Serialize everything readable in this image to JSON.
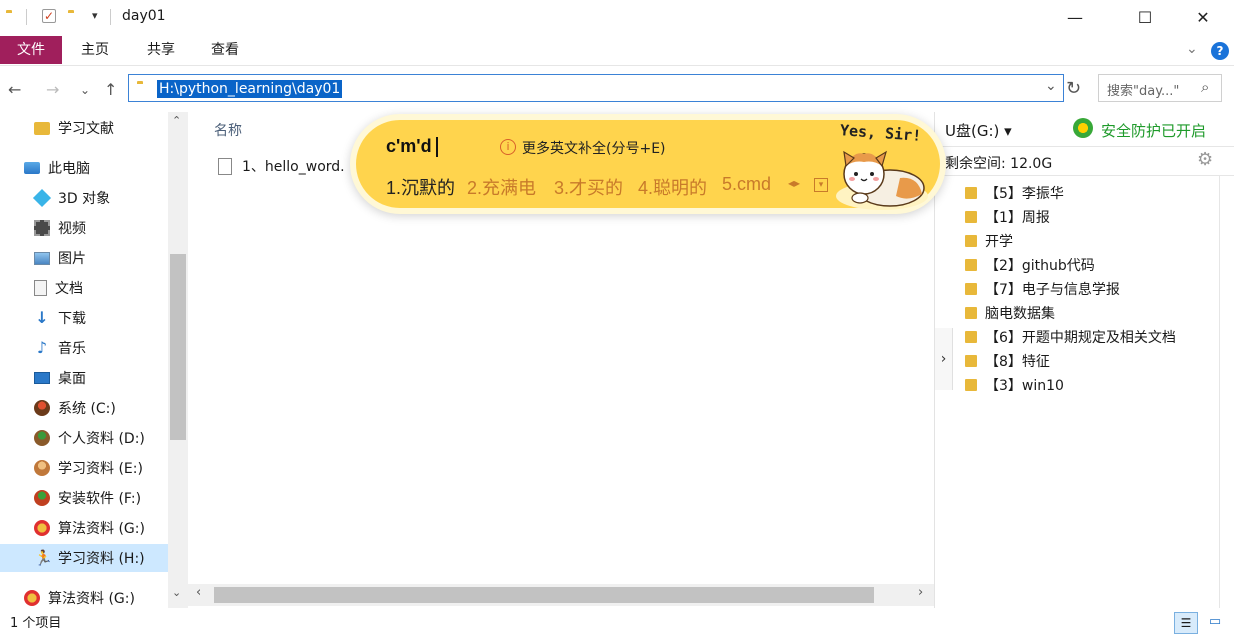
{
  "window": {
    "title": "day01",
    "minimize": "—",
    "maximize": "☐",
    "close": "✕"
  },
  "ribbon": {
    "tabs": [
      "文件",
      "主页",
      "共享",
      "查看"
    ],
    "help": "?"
  },
  "address": {
    "path": "H:\\python_learning\\day01",
    "search_placeholder": "搜索\"day...\"",
    "dropdown": "⌄",
    "refresh": "↻"
  },
  "left_nav": {
    "items": [
      {
        "label": "学习文献",
        "icon": "folder-icon"
      },
      {
        "label": "此电脑",
        "icon": "computer-icon"
      },
      {
        "label": "3D 对象",
        "icon": "3d-objects-icon"
      },
      {
        "label": "视频",
        "icon": "video-icon"
      },
      {
        "label": "图片",
        "icon": "pictures-icon"
      },
      {
        "label": "文档",
        "icon": "documents-icon"
      },
      {
        "label": "下载",
        "icon": "download-icon"
      },
      {
        "label": "音乐",
        "icon": "music-icon"
      },
      {
        "label": "桌面",
        "icon": "desktop-icon"
      },
      {
        "label": "系统 (C:)",
        "icon": "drive-icon"
      },
      {
        "label": "个人资料 (D:)",
        "icon": "drive-icon"
      },
      {
        "label": "学习资料 (E:)",
        "icon": "drive-icon"
      },
      {
        "label": "安装软件 (F:)",
        "icon": "drive-icon"
      },
      {
        "label": "算法资料 (G:)",
        "icon": "drive-icon"
      },
      {
        "label": "学习资料 (H:)",
        "icon": "drive-icon"
      },
      {
        "label": "算法资料 (G:)",
        "icon": "drive-icon"
      }
    ]
  },
  "main": {
    "column_name": "名称",
    "files": [
      {
        "name": "1、hello_word.",
        "icon": "file-icon"
      }
    ]
  },
  "right_panel": {
    "drive": "U盘(G:)",
    "security": "安全防护已开启",
    "free_space": "剩余空间: 12.0G",
    "folders": [
      "【5】李振华",
      "【1】周报",
      "开学",
      "【2】github代码",
      "【7】电子与信息学报",
      "脑电数据集",
      "【6】开题中期规定及相关文档",
      "【8】特征",
      "【3】win10"
    ]
  },
  "ime": {
    "input": "c'm'd",
    "hint": "更多英文补全(分号+E)",
    "candidates": [
      "1.沉默的",
      "2.充满电",
      "3.才买的",
      "4.聪明的",
      "5.cmd"
    ],
    "mascot_text": "Yes, Sir!",
    "colors": {
      "bg": "#ffd44d",
      "candidate": "#c87a2a"
    }
  },
  "status": {
    "count": "1 个项目"
  }
}
